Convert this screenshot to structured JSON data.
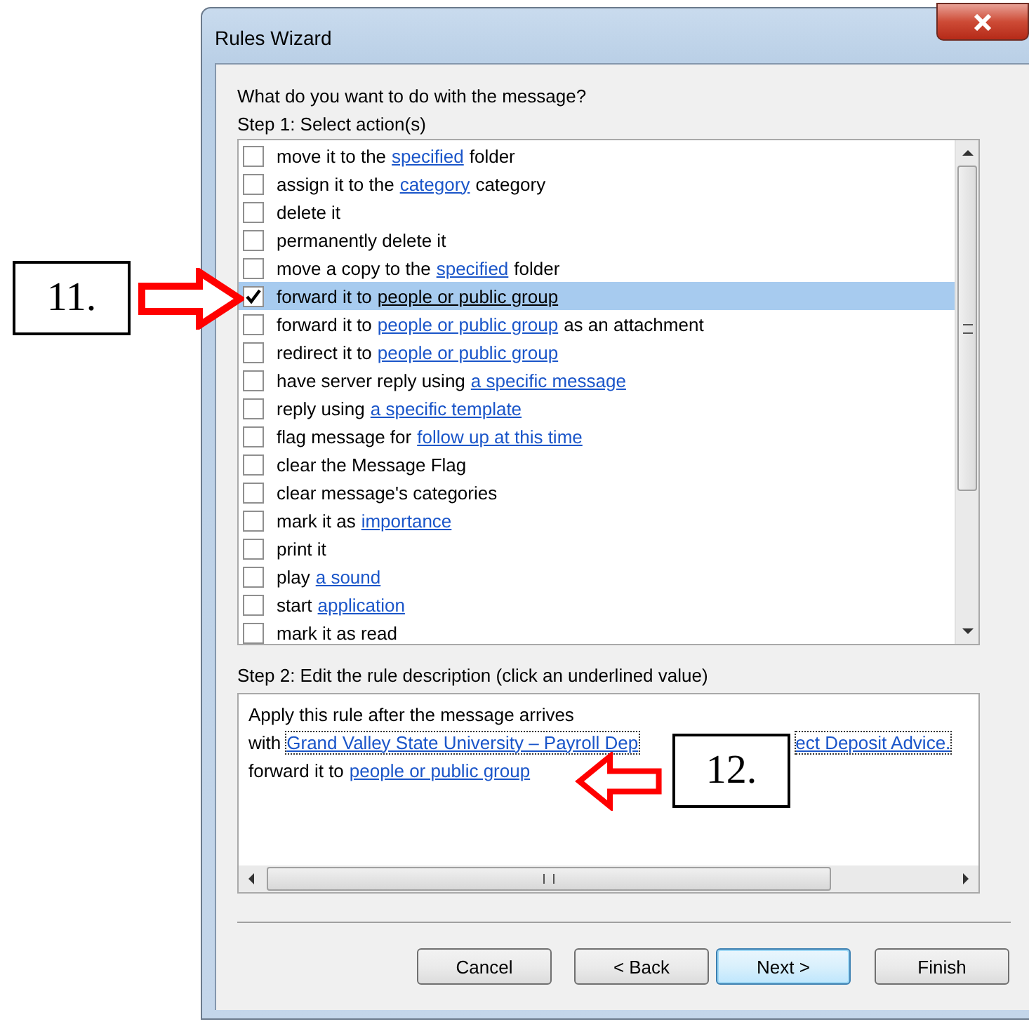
{
  "window": {
    "title": "Rules Wizard"
  },
  "prompt": "What do you want to do with the message?",
  "step1_label": "Step 1: Select action(s)",
  "actions": [
    {
      "checked": false,
      "selected": false,
      "parts": [
        {
          "kind": "text",
          "text": "move it to the"
        },
        {
          "kind": "link",
          "text": "specified"
        },
        {
          "kind": "text",
          "text": "folder"
        }
      ]
    },
    {
      "checked": false,
      "selected": false,
      "parts": [
        {
          "kind": "text",
          "text": "assign it to the"
        },
        {
          "kind": "link",
          "text": "category"
        },
        {
          "kind": "text",
          "text": "category"
        }
      ]
    },
    {
      "checked": false,
      "selected": false,
      "parts": [
        {
          "kind": "text",
          "text": "delete it"
        }
      ]
    },
    {
      "checked": false,
      "selected": false,
      "parts": [
        {
          "kind": "text",
          "text": "permanently delete it"
        }
      ]
    },
    {
      "checked": false,
      "selected": false,
      "parts": [
        {
          "kind": "text",
          "text": "move a copy to the"
        },
        {
          "kind": "link",
          "text": "specified"
        },
        {
          "kind": "text",
          "text": "folder"
        }
      ]
    },
    {
      "checked": true,
      "selected": true,
      "parts": [
        {
          "kind": "text",
          "text": "forward it to"
        },
        {
          "kind": "link",
          "text": "people or public group"
        }
      ]
    },
    {
      "checked": false,
      "selected": false,
      "parts": [
        {
          "kind": "text",
          "text": "forward it to"
        },
        {
          "kind": "link",
          "text": "people or public group"
        },
        {
          "kind": "text",
          "text": "as an attachment"
        }
      ]
    },
    {
      "checked": false,
      "selected": false,
      "parts": [
        {
          "kind": "text",
          "text": "redirect it to"
        },
        {
          "kind": "link",
          "text": "people or public group"
        }
      ]
    },
    {
      "checked": false,
      "selected": false,
      "parts": [
        {
          "kind": "text",
          "text": "have server reply using"
        },
        {
          "kind": "link",
          "text": "a specific message"
        }
      ]
    },
    {
      "checked": false,
      "selected": false,
      "parts": [
        {
          "kind": "text",
          "text": "reply using"
        },
        {
          "kind": "link",
          "text": "a specific template"
        }
      ]
    },
    {
      "checked": false,
      "selected": false,
      "parts": [
        {
          "kind": "text",
          "text": "flag message for"
        },
        {
          "kind": "link",
          "text": "follow up at this time"
        }
      ]
    },
    {
      "checked": false,
      "selected": false,
      "parts": [
        {
          "kind": "text",
          "text": "clear the Message Flag"
        }
      ]
    },
    {
      "checked": false,
      "selected": false,
      "parts": [
        {
          "kind": "text",
          "text": "clear message's categories"
        }
      ]
    },
    {
      "checked": false,
      "selected": false,
      "parts": [
        {
          "kind": "text",
          "text": "mark it as"
        },
        {
          "kind": "link",
          "text": "importance"
        }
      ]
    },
    {
      "checked": false,
      "selected": false,
      "parts": [
        {
          "kind": "text",
          "text": "print it"
        }
      ]
    },
    {
      "checked": false,
      "selected": false,
      "parts": [
        {
          "kind": "text",
          "text": "play"
        },
        {
          "kind": "link",
          "text": "a sound"
        }
      ]
    },
    {
      "checked": false,
      "selected": false,
      "parts": [
        {
          "kind": "text",
          "text": "start"
        },
        {
          "kind": "link",
          "text": "application"
        }
      ]
    },
    {
      "checked": false,
      "selected": false,
      "parts": [
        {
          "kind": "text",
          "text": "mark it as read"
        }
      ]
    }
  ],
  "step2_label": "Step 2: Edit the rule description (click an underlined value)",
  "description": [
    [
      {
        "kind": "text",
        "text": "Apply this rule after the message arrives"
      }
    ],
    [
      {
        "kind": "text",
        "text": "with"
      },
      {
        "kind": "focused-link",
        "text": "Grand Valley State University – Payroll Dep"
      },
      {
        "kind": "covered"
      },
      {
        "kind": "focused-link",
        "text": "ect Deposit Advice."
      }
    ],
    [
      {
        "kind": "text",
        "text": "forward it to"
      },
      {
        "kind": "link",
        "text": "people or public group"
      }
    ]
  ],
  "buttons": [
    {
      "label": "Cancel",
      "default": false
    },
    {
      "label": "< Back",
      "default": false
    },
    {
      "label": "Next >",
      "default": true
    },
    {
      "label": "Finish",
      "default": false
    }
  ],
  "annotations": [
    {
      "label": "11."
    },
    {
      "label": "12."
    }
  ]
}
